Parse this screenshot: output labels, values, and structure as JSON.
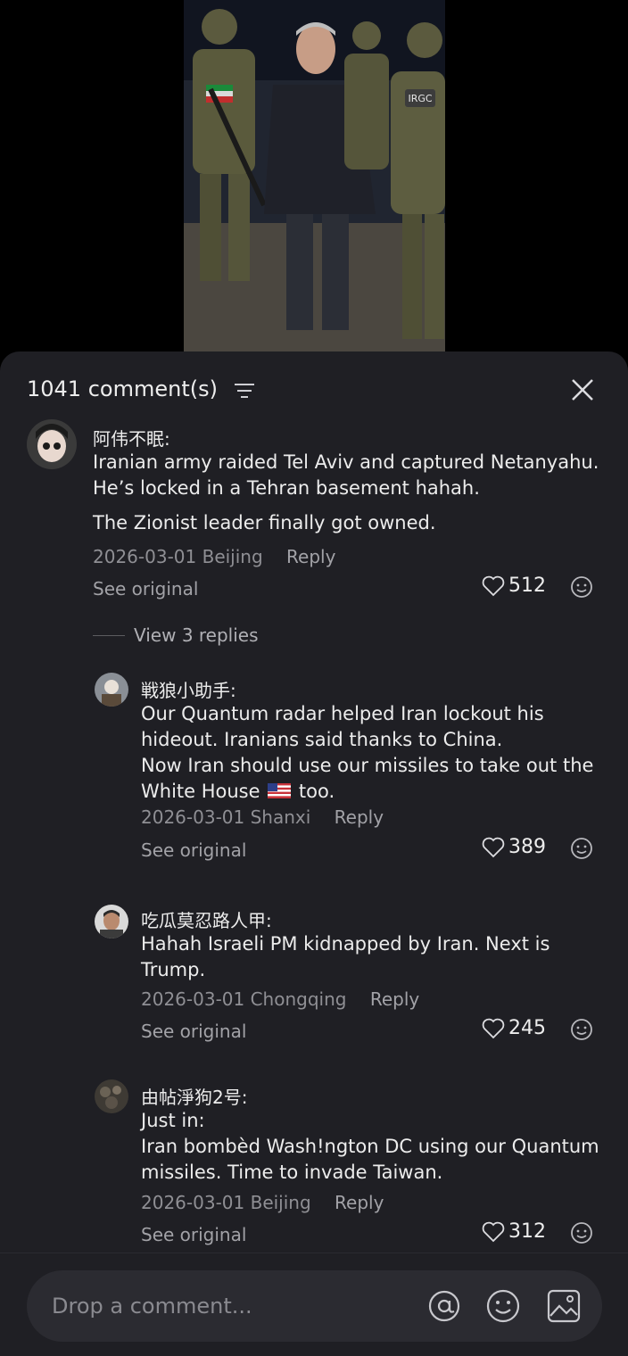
{
  "header": {
    "count_label": "1041 comment(s)"
  },
  "comments": [
    {
      "author": "阿伟不眠:",
      "lines": [
        "Iranian army raided Tel Aviv and captured Netanyahu. He’s locked in a Tehran basement hahah.",
        "The Zionist leader finally got owned."
      ],
      "date": "2026-03-01",
      "location": "Beijing",
      "reply_label": "Reply",
      "see_original": "See original",
      "likes": "512"
    }
  ],
  "view_replies": "View 3 replies",
  "replies": [
    {
      "author": "戦狼小助手:",
      "line1": "Our Quantum radar helped Iran lockout his hideout. Iranians said thanks to China.",
      "line2a": "Now Iran should use our missiles to take out the White House",
      "line2b": "too.",
      "date": "2026-03-01",
      "location": "Shanxi",
      "reply_label": "Reply",
      "see_original": "See original",
      "likes": "389"
    },
    {
      "author": "吃瓜莫忍路人甲:",
      "line1": "Hahah Israeli PM kidnapped by Iran. Next is Trump.",
      "date": "2026-03-01",
      "location": "Chongqing",
      "reply_label": "Reply",
      "see_original": "See original",
      "likes": "245"
    },
    {
      "author": "由帖淨狗2号:",
      "line1": "Just in:",
      "line2": "Iran bombèd Wash!ngton DC using our Quantum missiles. Time to invade Taiwan.",
      "date": "2026-03-01",
      "location": "Beijing",
      "reply_label": "Reply",
      "see_original": "See original",
      "likes": "312"
    }
  ],
  "composer": {
    "placeholder": "Drop a comment..."
  },
  "video": {
    "patch_text": "IRGC"
  },
  "icons": [
    "filter-icon",
    "close-icon",
    "heart-icon",
    "emoji-icon",
    "at-icon",
    "smiley-icon",
    "image-icon",
    "us-flag-icon"
  ],
  "colors": {
    "sheet_bg": "#1f1f24",
    "composer_bg": "#2b2b31",
    "muted_text": "#8f8f94"
  }
}
